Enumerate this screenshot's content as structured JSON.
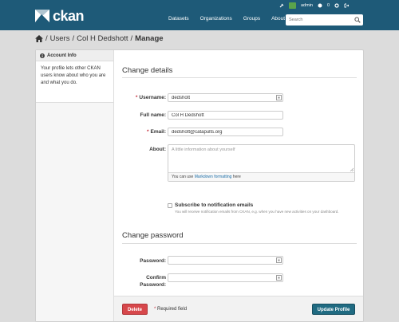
{
  "header": {
    "brand": "ckan",
    "nav": [
      "Datasets",
      "Organizations",
      "Groups",
      "About"
    ],
    "search_placeholder": "Search",
    "user": {
      "name": "admin",
      "count": "0"
    }
  },
  "breadcrumb": {
    "items": [
      "Users",
      "Col H Dedshott"
    ],
    "active": "Manage"
  },
  "sidebar": {
    "title": "Account Info",
    "body": "Your profile lets other CKAN users know about who you are and what you do."
  },
  "details": {
    "heading": "Change details",
    "username": {
      "label": "Username:",
      "value": "dedshott"
    },
    "fullname": {
      "label": "Full name:",
      "value": "Col H Dedshott"
    },
    "email": {
      "label": "Email:",
      "value": "dedshott@catapults.org"
    },
    "about": {
      "label": "About:",
      "placeholder": "A little information about yourself",
      "hint_prefix": "You can use ",
      "hint_link": "Markdown formatting",
      "hint_suffix": " here"
    },
    "subscribe": {
      "label": "Subscribe to notification emails",
      "help": "You will receive notification emails from CKAN, e.g. when you have new activities on your dashboard."
    }
  },
  "password": {
    "heading": "Change password",
    "password_label": "Password:",
    "confirm_label_1": "Confirm",
    "confirm_label_2": "Password:"
  },
  "actions": {
    "delete": "Delete",
    "required_marker": "*",
    "required_note": " Required field",
    "update": "Update Profile"
  },
  "colors": {
    "masthead": "#1e5a78",
    "update_button": "#206b82",
    "delete_button": "#d7474b",
    "required": "#c6303e"
  }
}
